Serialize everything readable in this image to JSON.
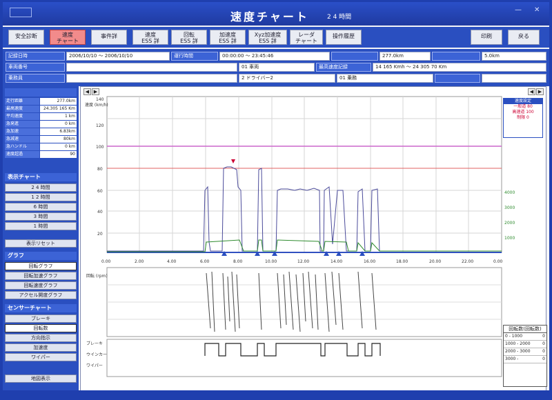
{
  "window": {
    "title": "速度チャート",
    "subtitle": "2 4 時間"
  },
  "toolbar": {
    "buttons": [
      {
        "label": "安全診断",
        "sub": ""
      },
      {
        "label": "速度",
        "sub": "チャート"
      },
      {
        "label": "事件詳",
        "sub": ""
      },
      {
        "label": "速度",
        "sub": "ESS 詳"
      },
      {
        "label": "回転",
        "sub": "ESS 詳"
      },
      {
        "label": "加速度",
        "sub": "ESS 詳"
      },
      {
        "label": "Xyz加速度",
        "sub": "ESS 詳"
      },
      {
        "label": "レーダ",
        "sub": "チャート"
      },
      {
        "label": "操作履歴",
        "sub": ""
      }
    ],
    "print": "印刷",
    "back": "戻る"
  },
  "info": {
    "row1": {
      "l1": "記録日時",
      "v1": "2006/10/10 ～ 2006/10/10",
      "l2": "運行時間",
      "v2": "00:00:00 ～ 23:45:46",
      "l3": "",
      "v3": "277.0km",
      "l4": "",
      "v4": "5.0km"
    },
    "row2": {
      "l1": "車両番号",
      "v1": "",
      "v2": "01 車両",
      "l3": "最高速度記録",
      "v3": "14 165 Kmh ～ 24 305 70 Km"
    },
    "row3": {
      "l1": "乗務員",
      "v1": "",
      "v2": "2 ドライバー2",
      "v3": "01 乗務",
      "v4": ""
    }
  },
  "left": {
    "stats": [
      {
        "k": "走行距離",
        "v": "277.0km"
      },
      {
        "k": "最高速度",
        "v": "24.305 165 Km"
      },
      {
        "k": "平均速度",
        "v": "1 km"
      },
      {
        "k": "急発進",
        "v": "0 km"
      },
      {
        "k": "急加速",
        "v": "6.83km"
      },
      {
        "k": "急減速",
        "v": "80km"
      },
      {
        "k": "急ハンドル",
        "v": "0 km"
      },
      {
        "k": "速度超過",
        "v": "90"
      }
    ],
    "range_header": "表示チャート",
    "range_buttons": [
      "2 4 時間",
      "1 2 時間",
      "6 時間",
      "3 時間",
      "1 時間"
    ],
    "reset_btn": "表示リセット",
    "graph_header": "グラフ",
    "graph_buttons": [
      "回転グラフ",
      "回転加速グラフ",
      "回転速度グラフ",
      "アクセル開度グラフ"
    ],
    "sensor_header": "センサーチャート",
    "sensor_buttons": [
      "ブレーキ",
      "回転数",
      "方向指示",
      "加速度",
      "ワイパー"
    ],
    "bottom_btn": "地図表示"
  },
  "chart": {
    "y_ticks": [
      "140",
      "120",
      "100",
      "80",
      "60",
      "40",
      "20"
    ],
    "y_title": "速度 (km/h)",
    "x_ticks": [
      "0.00",
      "2.00",
      "4.00",
      "6.00",
      "8.00",
      "10.00",
      "12.00",
      "14.00",
      "16.00",
      "18.00",
      "20.00",
      "22.00",
      "0.00"
    ],
    "rpm_title": "回転 (rpm)",
    "rpm_ticks": [
      "1000",
      "2000",
      "3000",
      "4000"
    ],
    "signal_labels": [
      "ブレーキ",
      "ウインカー",
      "ワイパー"
    ],
    "legend_header": "速度設定",
    "legend_items": [
      "一般道 80",
      "高速道 100",
      "制限 0"
    ],
    "ntable_title": "回転数(回転数)",
    "ntable_rows": [
      {
        "k": "0 - 1000",
        "v": "0"
      },
      {
        "k": "1000 - 2000",
        "v": "0"
      },
      {
        "k": "2000 - 3000",
        "v": "0"
      },
      {
        "k": "3000 -",
        "v": "0"
      }
    ]
  },
  "colors": {
    "accent": "#2a4fc0",
    "speed_line": "#4a4a9a",
    "rpm_line": "#2e8b2e",
    "limit_high": "#cc66cc",
    "limit_low": "#e06060"
  }
}
